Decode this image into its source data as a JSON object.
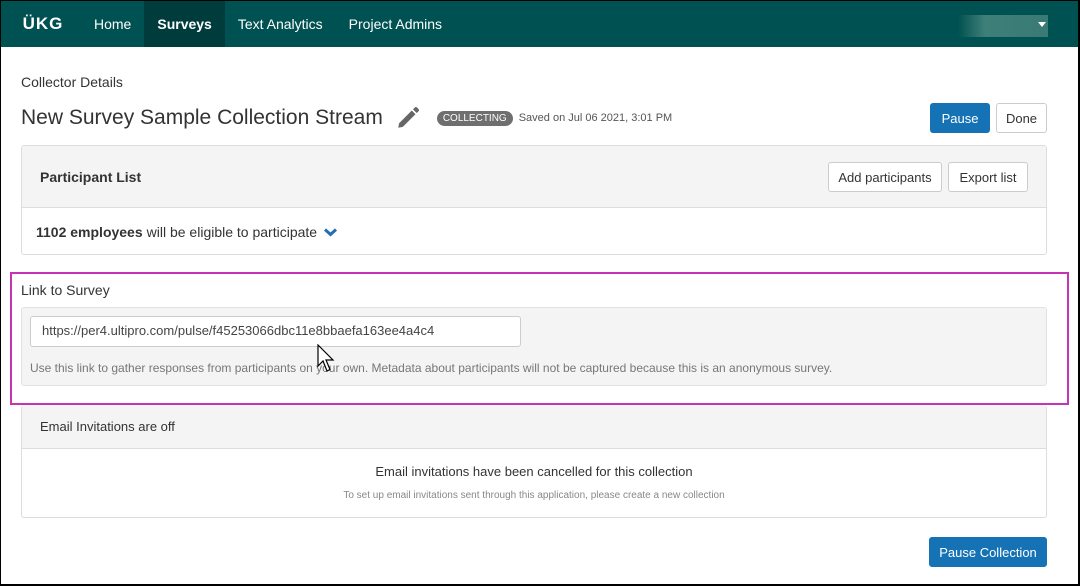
{
  "nav": {
    "logo": "ÜKG",
    "items": [
      {
        "label": "Home",
        "active": false
      },
      {
        "label": "Surveys",
        "active": true
      },
      {
        "label": "Text Analytics",
        "active": false
      },
      {
        "label": "Project Admins",
        "active": false
      }
    ],
    "user_menu_icon": "caret-down-icon"
  },
  "page": {
    "breadcrumb": "Collector Details",
    "title": "New Survey Sample Collection Stream",
    "edit_icon": "pencil-icon",
    "status_badge": "COLLECTING",
    "saved_text": "Saved on Jul 06 2021, 3:01 PM",
    "pause_label": "Pause",
    "done_label": "Done"
  },
  "participants": {
    "heading": "Participant List",
    "add_label": "Add participants",
    "export_label": "Export list",
    "count_bold": "1102 employees",
    "count_rest": "will be eligible to participate",
    "expand_icon": "chevron-down-icon"
  },
  "link": {
    "heading": "Link to Survey",
    "url": "https://per4.ultipro.com/pulse/f45253066dbc11e8bbaefa163ee4a4c4",
    "help": "Use this link to gather responses from participants on your own. Metadata about participants will not be captured because this is an anonymous survey."
  },
  "email": {
    "heading": "Email Invitations are off",
    "message": "Email invitations have been cancelled for this collection",
    "sub_message": "To set up email invitations sent through this application, please create a new collection"
  },
  "footer": {
    "pause_collection_label": "Pause Collection"
  },
  "colors": {
    "nav_bg": "#005151",
    "nav_active": "#003c3c",
    "primary": "#1572b5",
    "highlight": "#c633b4",
    "badge": "#6f6f6f"
  }
}
